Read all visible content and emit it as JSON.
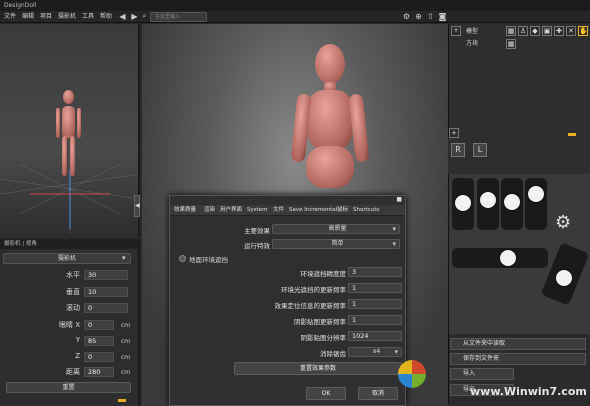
{
  "app": {
    "title": "DesignDoll"
  },
  "menu": [
    "文件",
    "编辑",
    "项目",
    "摄影机",
    "工具",
    "帮助"
  ],
  "search": {
    "placeholder": "在这里输入"
  },
  "camera_panel": {
    "tabs": "摄影机 | 视角",
    "camera_select": "摄影机",
    "fields": [
      {
        "label": "水平",
        "value": "30"
      },
      {
        "label": "垂直",
        "value": "10"
      },
      {
        "label": "滚动",
        "value": "0"
      },
      {
        "label": "眼睛 X",
        "value": "0",
        "unit": "cm"
      },
      {
        "label": "Y",
        "value": "85",
        "unit": "cm"
      },
      {
        "label": "Z",
        "value": "0",
        "unit": "cm"
      },
      {
        "label": "距离",
        "value": "280",
        "unit": "cm"
      }
    ],
    "reset_label": "重置"
  },
  "dialog": {
    "tabs": [
      "效果质量",
      "渲染",
      "用户界面",
      "System",
      "文件",
      "Save Incremental",
      "鼠标",
      "Shortcuts"
    ],
    "main_effect_label": "主要效果",
    "main_effect_value": "高质量",
    "runtime_label": "运行特效",
    "runtime_value": "简单",
    "ao_label": "地面环境遮挡",
    "fields": [
      {
        "label": "环境遮挡精度度",
        "value": "3"
      },
      {
        "label": "环境光遮挡的更新频率",
        "value": "1"
      },
      {
        "label": "效果定位信息的更新频率",
        "value": "1"
      },
      {
        "label": "阴影贴图更新频率",
        "value": "1"
      },
      {
        "label": "阴影贴图分辨率",
        "value": "1024"
      }
    ],
    "aa_label": "消除锯齿",
    "aa_value": "x4",
    "reset_label": "重置效果参数",
    "ok_label": "OK",
    "cancel_label": "取消"
  },
  "layers": [
    {
      "name": "模型"
    },
    {
      "name": "方块"
    }
  ],
  "right_buttons": {
    "r_label": "R",
    "l_label": "L",
    "load_from_file": "从文件夹中读取",
    "save_to_file": "保存到文件夹",
    "import": "导入",
    "export": "导出"
  },
  "watermark": "www.Winwin7.com"
}
